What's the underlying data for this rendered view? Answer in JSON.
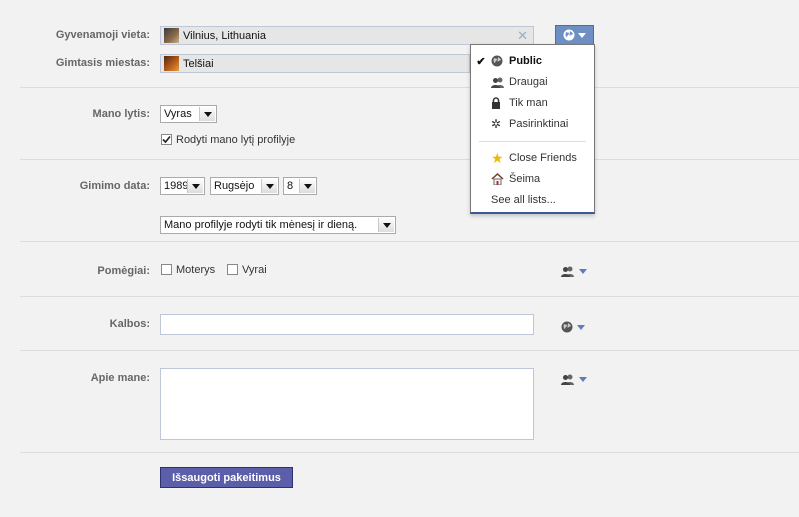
{
  "residence": {
    "label": "Gyvenamoji vieta:",
    "value": "Vilnius, Lithuania"
  },
  "hometown": {
    "label": "Gimtasis miestas:",
    "value": "Telšiai"
  },
  "gender": {
    "label": "Mano lytis:",
    "value": "Vyras",
    "show_label": "Rodyti mano lytį profilyje",
    "show_checked": true
  },
  "birthday": {
    "label": "Gimimo data:",
    "year": "1989",
    "month": "Rugsėjo",
    "day": "8",
    "visibility": "Mano profilyje rodyti tik mėnesį ir dieną."
  },
  "interests": {
    "label": "Pomėgiai:",
    "women": "Moterys",
    "men": "Vyrai"
  },
  "languages": {
    "label": "Kalbos:",
    "value": ""
  },
  "about": {
    "label": "Apie mane:",
    "value": ""
  },
  "save_label": "Išsaugoti pakeitimus",
  "privacy_menu": {
    "items": [
      "Public",
      "Draugai",
      "Tik man",
      "Pasirinktinai"
    ],
    "lists": [
      "Close Friends",
      "Šeima"
    ],
    "see_all": "See all lists...",
    "selected": "Public"
  },
  "colors": {
    "accent": "#6d8fc4",
    "save_button": "#5b5ea8"
  }
}
